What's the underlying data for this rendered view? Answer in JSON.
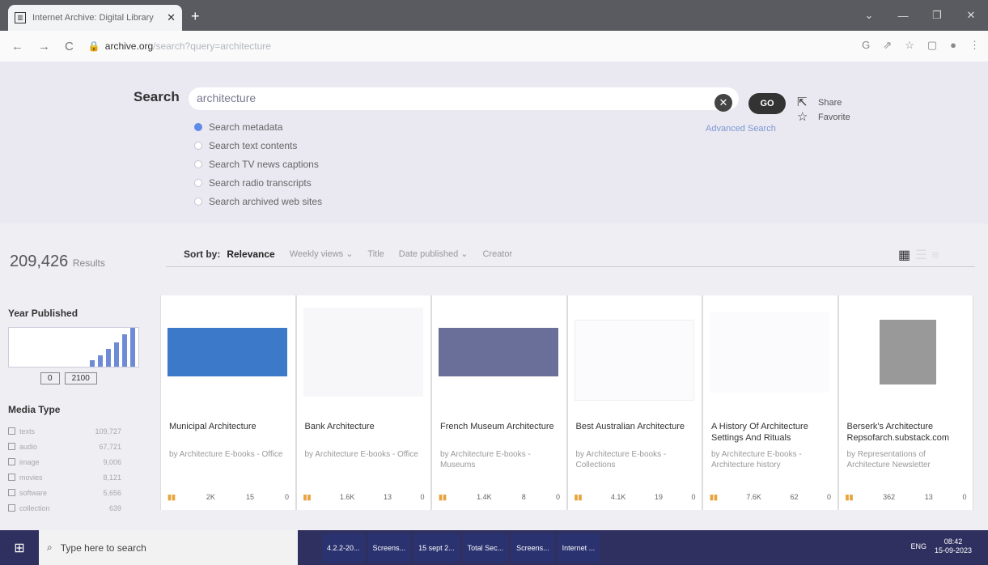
{
  "browser": {
    "tab_title": "Internet Archive: Digital Library",
    "url_domain": "archive.org",
    "url_path": "/search?query=architecture"
  },
  "search": {
    "label": "Search",
    "query": "architecture",
    "go": "GO",
    "advanced": "Advanced Search",
    "share": "Share",
    "favorite": "Favorite",
    "options": [
      "Search metadata",
      "Search text contents",
      "Search TV news captions",
      "Search radio transcripts",
      "Search archived web sites"
    ],
    "selected_option": 0
  },
  "results": {
    "count": "209,426",
    "label": "Results"
  },
  "sort": {
    "label": "Sort by:",
    "options": [
      "Relevance",
      "Weekly views ⌄",
      "Title",
      "Date published ⌄",
      "Creator"
    ],
    "active": 0
  },
  "sidebar": {
    "year_title": "Year Published",
    "year_from": "0",
    "year_to": "2100",
    "media_title": "Media Type",
    "media": [
      {
        "name": "texts",
        "count": "109,727"
      },
      {
        "name": "audio",
        "count": "67,721"
      },
      {
        "name": "image",
        "count": "9,006"
      },
      {
        "name": "movies",
        "count": "8,121"
      },
      {
        "name": "software",
        "count": "5,656"
      },
      {
        "name": "collection",
        "count": "639"
      }
    ]
  },
  "cards": [
    {
      "title": "Municipal Architecture",
      "by": "by Architecture E-books - Office",
      "views": "2K",
      "favs": "15",
      "reviews": "0"
    },
    {
      "title": "Bank Architecture",
      "by": "by Architecture E-books - Office",
      "views": "1.6K",
      "favs": "13",
      "reviews": "0"
    },
    {
      "title": "French Museum Architecture",
      "by": "by Architecture E-books - Museums",
      "views": "1.4K",
      "favs": "8",
      "reviews": "0"
    },
    {
      "title": "Best Australian Architecture",
      "by": "by Architecture E-books - Collections",
      "views": "4.1K",
      "favs": "19",
      "reviews": "0"
    },
    {
      "title": "A History Of Architecture Settings And Rituals",
      "by": "by Architecture E-books - Architecture history",
      "views": "7.6K",
      "favs": "62",
      "reviews": "0"
    },
    {
      "title": "Berserk's Architecture Repsofarch.substack.com",
      "by": "by Representations of Architecture Newsletter",
      "views": "362",
      "favs": "13",
      "reviews": "0"
    }
  ],
  "taskbar": {
    "search": "Type here to search",
    "apps": [
      "4.2.2-20...",
      "Screens...",
      "15 sept 2...",
      "Total Sec...",
      "Screens...",
      "Internet ..."
    ],
    "lang": "ENG",
    "time": "08:42",
    "date": "15-09-2023"
  }
}
